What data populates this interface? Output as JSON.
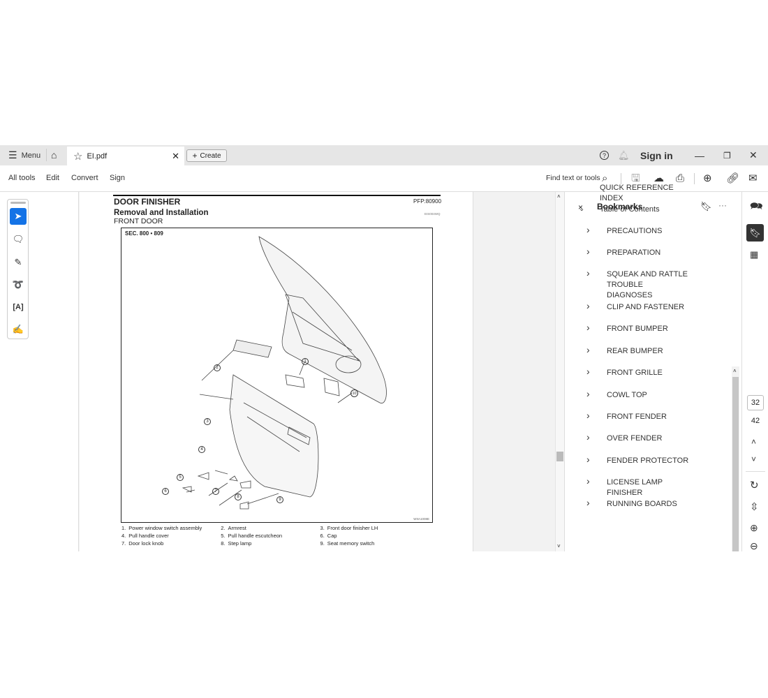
{
  "titlebar": {
    "menu": "Menu",
    "tab_name": "EI.pdf",
    "create": "Create",
    "sign_in": "Sign in"
  },
  "toolbar": {
    "all_tools": "All tools",
    "edit": "Edit",
    "convert": "Convert",
    "sign": "Sign",
    "find": "Find text or tools"
  },
  "document": {
    "title": "DOOR FINISHER",
    "pfp": "PFP:80900",
    "code": "EIS004WQ",
    "subtitle": "Removal and Installation",
    "section": "FRONT DOOR",
    "sec": "SEC. 800 • 809",
    "fig_id": "WIIA1008E",
    "callouts": [
      "1",
      "2",
      "3",
      "4",
      "5",
      "6",
      "7",
      "8",
      "9",
      "10"
    ],
    "legend": [
      [
        "1.",
        "Power window switch assembly",
        "2.",
        "Armrest",
        "3.",
        "Front door finisher LH"
      ],
      [
        "4.",
        "Pull handle cover",
        "5.",
        "Pull handle escutcheon",
        "6.",
        "Cap"
      ],
      [
        "7.",
        "Door lock knob",
        "8.",
        "Step lamp",
        "9.",
        "Seat memory switch"
      ]
    ]
  },
  "bookmarks": {
    "title": "Bookmarks",
    "items": [
      {
        "label": "QUICK REFERENCE INDEX",
        "level": 0,
        "expander": "none"
      },
      {
        "label": "Table of Contents",
        "level": 0,
        "expander": "expanded"
      },
      {
        "label": "PRECAUTIONS",
        "level": 1,
        "expander": "collapsed"
      },
      {
        "label": "PREPARATION",
        "level": 1,
        "expander": "collapsed"
      },
      {
        "label": "SQUEAK AND RATTLE TROUBLE DIAGNOSES",
        "level": 1,
        "expander": "collapsed"
      },
      {
        "label": "CLIP AND FASTENER",
        "level": 1,
        "expander": "collapsed"
      },
      {
        "label": "FRONT BUMPER",
        "level": 1,
        "expander": "collapsed"
      },
      {
        "label": "REAR BUMPER",
        "level": 1,
        "expander": "collapsed"
      },
      {
        "label": "FRONT GRILLE",
        "level": 1,
        "expander": "collapsed"
      },
      {
        "label": "COWL TOP",
        "level": 1,
        "expander": "collapsed"
      },
      {
        "label": "FRONT FENDER",
        "level": 1,
        "expander": "collapsed"
      },
      {
        "label": "OVER FENDER",
        "level": 1,
        "expander": "collapsed"
      },
      {
        "label": "FENDER PROTECTOR",
        "level": 1,
        "expander": "collapsed"
      },
      {
        "label": "LICENSE LAMP FINISHER",
        "level": 1,
        "expander": "collapsed"
      },
      {
        "label": "RUNNING BOARDS",
        "level": 1,
        "expander": "collapsed"
      }
    ]
  },
  "pagenav": {
    "current": "32",
    "total": "42"
  },
  "colors": {
    "accent": "#1473e6",
    "titlebar": "#e6e6e6"
  }
}
